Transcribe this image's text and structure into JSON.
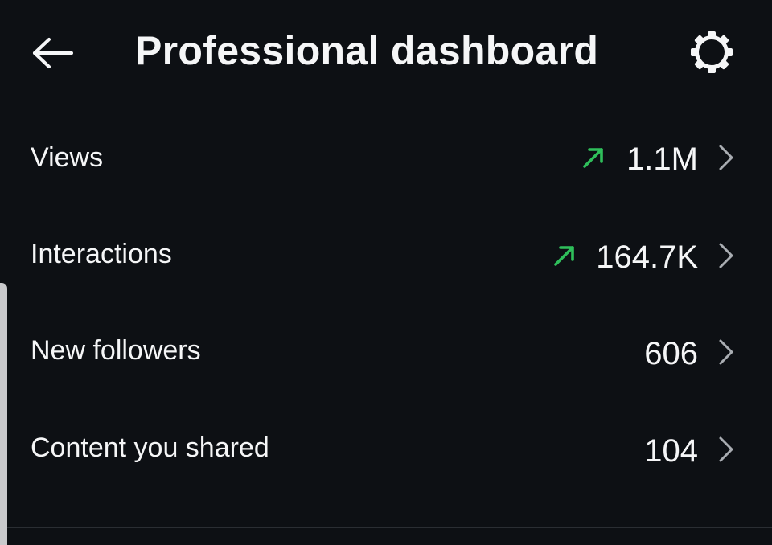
{
  "header": {
    "title": "Professional dashboard",
    "back_icon": "arrow-left-icon",
    "settings_icon": "gear-icon"
  },
  "rows": [
    {
      "label": "Views",
      "value": "1.1M",
      "trend": "up"
    },
    {
      "label": "Interactions",
      "value": "164.7K",
      "trend": "up"
    },
    {
      "label": "New followers",
      "value": "606",
      "trend": "none"
    },
    {
      "label": "Content you shared",
      "value": "104",
      "trend": "none"
    }
  ],
  "colors": {
    "background": "#0d1014",
    "text": "#f5f6f7",
    "trend_up": "#2fbf5b",
    "chevron": "#a9adb2"
  }
}
